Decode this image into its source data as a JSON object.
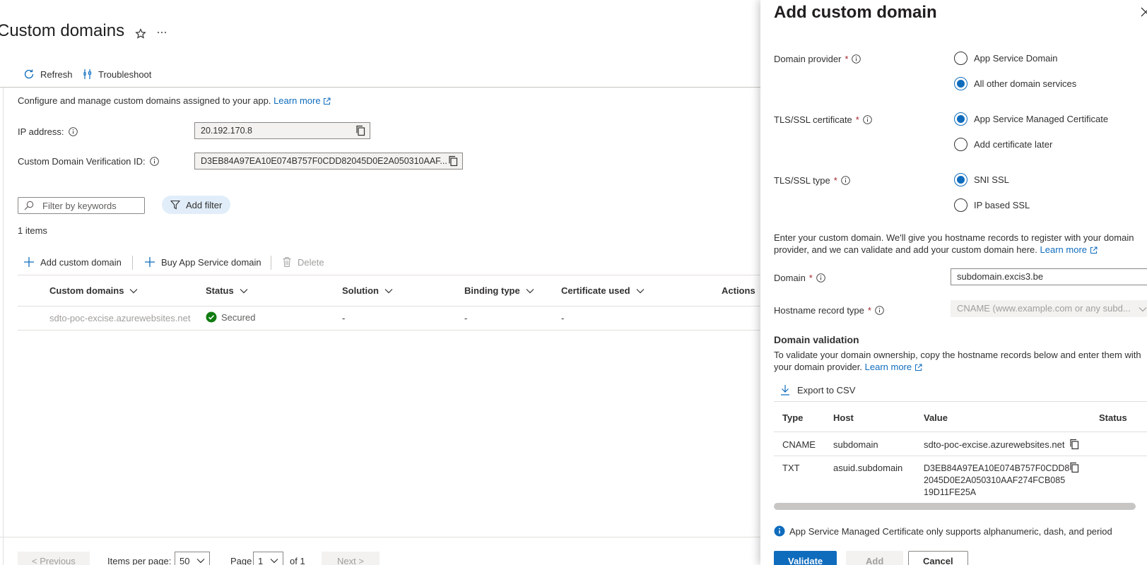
{
  "page": {
    "title": "Custom domains",
    "toolbar": {
      "refresh": "Refresh",
      "troubleshoot": "Troubleshoot"
    },
    "description": "Configure and manage custom domains assigned to your app.",
    "learn_more": "Learn more",
    "ip_label": "IP address:",
    "ip_value": "20.192.170.8",
    "verification_label": "Custom Domain Verification ID:",
    "verification_value": "D3EB84A97EA10E074B757F0CDD82045D0E2A050310AAF...",
    "filter_placeholder": "Filter by keywords",
    "add_filter": "Add filter",
    "item_count": "1 items",
    "actions": {
      "add": "Add custom domain",
      "buy": "Buy App Service domain",
      "delete": "Delete"
    },
    "columns": [
      "Custom domains",
      "Status",
      "Solution",
      "Binding type",
      "Certificate used",
      "Actions"
    ],
    "rows": [
      {
        "domain": "sdto-poc-excise.azurewebsites.net",
        "status": "Secured",
        "solution": "-",
        "binding": "-",
        "certificate": "-"
      }
    ],
    "pager": {
      "previous": "< Previous",
      "items_per_page_label": "Items per page:",
      "items_per_page": "50",
      "page_label": "Page",
      "page": "1",
      "of": "of 1",
      "next": "Next >"
    }
  },
  "panel": {
    "title": "Add custom domain",
    "domain_provider": {
      "label": "Domain provider",
      "options": [
        "App Service Domain",
        "All other domain services"
      ],
      "selected": 1
    },
    "tls_certificate": {
      "label": "TLS/SSL certificate",
      "options": [
        "App Service Managed Certificate",
        "Add certificate later"
      ],
      "selected": 0
    },
    "tls_type": {
      "label": "TLS/SSL type",
      "options": [
        "SNI SSL",
        "IP based SSL"
      ],
      "selected": 0
    },
    "intro": "Enter your custom domain. We'll give you hostname records to register with your domain provider, and we can validate and add your custom domain here.",
    "learn_more": "Learn more",
    "domain_label": "Domain",
    "domain_value": "subdomain.excis3.be",
    "hostname_label": "Hostname record type",
    "hostname_value": "CNAME (www.example.com or any subd...",
    "validation_title": "Domain validation",
    "validation_text": "To validate your domain ownership, copy the hostname records below and enter them with your domain provider.",
    "export_csv": "Export to CSV",
    "record_columns": [
      "Type",
      "Host",
      "Value",
      "Status"
    ],
    "records": [
      {
        "type": "CNAME",
        "host": "subdomain",
        "value": "sdto-poc-excise.azurewebsites.net"
      },
      {
        "type": "TXT",
        "host": "asuid.subdomain",
        "value_lines": [
          "D3EB84A97EA10E074B757F0CDD8",
          "2045D0E2A050310AAF274FCB085",
          "19D11FE25A"
        ]
      }
    ],
    "info_text": "App Service Managed Certificate only supports alphanumeric, dash, and period",
    "buttons": {
      "validate": "Validate",
      "add": "Add",
      "cancel": "Cancel"
    }
  },
  "colors": {
    "accent": "#0f6cbd",
    "success": "#107c10",
    "required": "#a4262c",
    "muted": "#a19f9d"
  },
  "icons": [
    "star-icon",
    "more-icon",
    "refresh-icon",
    "troubleshoot-icon",
    "external-link-icon",
    "info-icon",
    "copy-icon",
    "search-icon",
    "filter-icon",
    "plus-icon",
    "delete-icon",
    "chevron-down-icon",
    "success-icon",
    "close-icon",
    "download-icon"
  ]
}
